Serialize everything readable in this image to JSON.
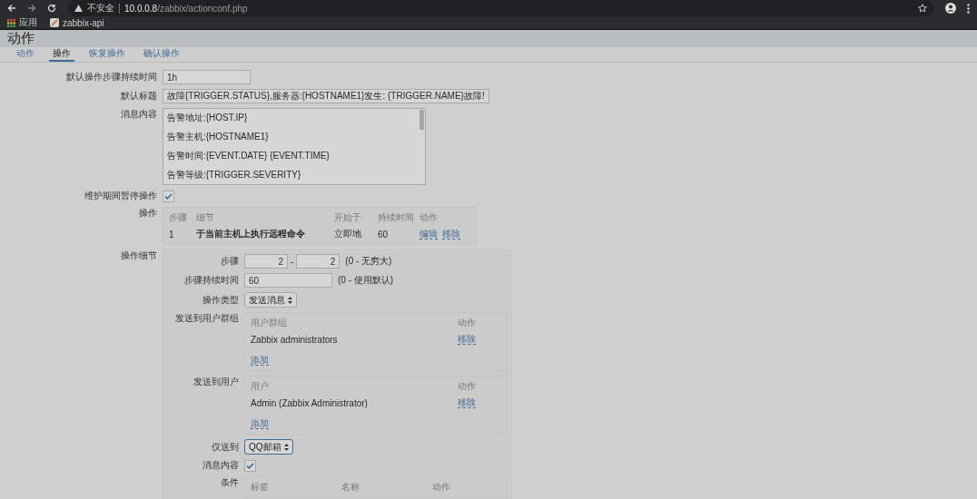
{
  "browser": {
    "security_label": "不安全",
    "url_host": "10.0.0.8",
    "url_path": "/zabbix/actionconf.php",
    "bookmarks": [
      {
        "label": "应用",
        "kind": "apps"
      },
      {
        "label": "zabbix-api",
        "kind": "site"
      }
    ]
  },
  "page_title": "动作",
  "tabs": [
    {
      "label": "动作",
      "selected": false
    },
    {
      "label": "操作",
      "selected": true
    },
    {
      "label": "恢复操作",
      "selected": false
    },
    {
      "label": "确认操作",
      "selected": false
    }
  ],
  "form": {
    "default_step_duration": {
      "label": "默认操作步骤持续时间",
      "value": "1h"
    },
    "default_subject": {
      "label": "默认标题",
      "value": "故障{TRIGGER.STATUS},服务器:{HOSTNAME1}发生: {TRIGGER.NAME}故障!"
    },
    "default_message": {
      "label": "消息内容",
      "lines": [
        "告警地址:{HOST.IP}",
        "告警主机:{HOSTNAME1}",
        "告警时间:{EVENT.DATE} {EVENT.TIME}",
        "告警等级:{TRIGGER.SEVERITY}"
      ]
    },
    "pause_in_maintenance": {
      "label": "维护期间暂停操作",
      "checked": true
    },
    "operations": {
      "label": "操作",
      "columns": [
        "步骤",
        "细节",
        "开始于",
        "持续时间",
        "动作"
      ],
      "rows": [
        {
          "step": "1",
          "details": "于当前主机上执行远程命令",
          "start": "立即地",
          "duration": "60",
          "actions": [
            "编辑",
            "移除"
          ]
        }
      ]
    },
    "operation_details": {
      "label": "操作细节",
      "steps": {
        "label": "步骤",
        "from": "2",
        "separator": "-",
        "to": "2",
        "hint": "(0 - 无穷大)"
      },
      "step_duration": {
        "label": "步骤持续时间",
        "value": "60",
        "hint": "(0 - 使用默认)"
      },
      "operation_type": {
        "label": "操作类型",
        "value": "发送消息"
      },
      "user_groups": {
        "label": "发送到用户群组",
        "columns": [
          "用户群组",
          "动作"
        ],
        "rows": [
          {
            "name": "Zabbix administrators",
            "action": "移除"
          }
        ],
        "add": "添加"
      },
      "users": {
        "label": "发送到用户",
        "columns": [
          "用户",
          "动作"
        ],
        "rows": [
          {
            "name": "Admin (Zabbix Administrator)",
            "action": "移除"
          }
        ],
        "add": "添加"
      },
      "send_only_to": {
        "label": "仅送到",
        "value": "QQ邮箱"
      },
      "message_content": {
        "label": "消息内容",
        "checked": true
      },
      "conditions": {
        "label": "条件",
        "columns": [
          "标签",
          "名称",
          "动作"
        ]
      }
    }
  }
}
